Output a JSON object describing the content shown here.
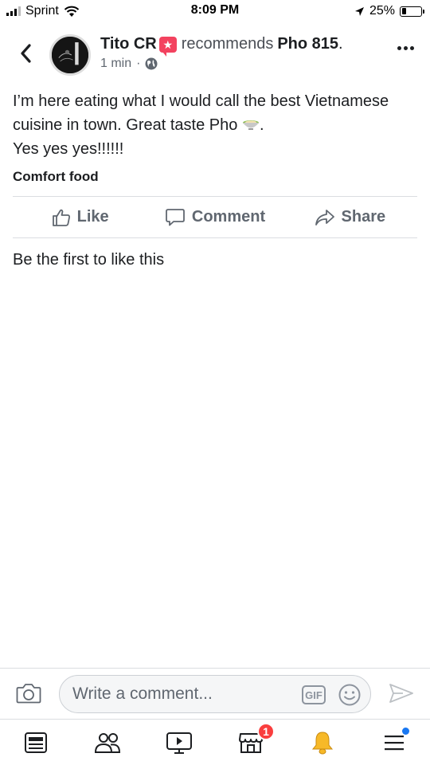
{
  "status_bar": {
    "carrier": "Sprint",
    "time": "8:09 PM",
    "battery_percent": "25%",
    "battery_level": 0.25
  },
  "post": {
    "author": "Tito CR",
    "action_text": "recommends",
    "page_name": "Pho 815",
    "page_suffix": ".",
    "timestamp": "1 min",
    "meta_separator": "·",
    "privacy_icon": "globe-icon",
    "text_lines": [
      "I’m here eating what I would call the best Vietnamese",
      "cuisine in town. Great taste Pho",
      "Yes yes yes!!!!!!"
    ],
    "emoji_suffix": ".",
    "tag": "Comfort food"
  },
  "actions": {
    "like": "Like",
    "comment": "Comment",
    "share": "Share"
  },
  "reactions_text": "Be the first to like this",
  "comment_bar": {
    "placeholder": "Write a comment...",
    "gif_label": "GIF"
  },
  "tab_bar": {
    "marketplace_badge": "1"
  },
  "colors": {
    "text": "#1c1e21",
    "secondary": "#606770",
    "recommend_badge": "#f3425f",
    "notification_badge": "#fa3e3e",
    "bell": "#f7b928",
    "accent_dot": "#1877f2"
  }
}
